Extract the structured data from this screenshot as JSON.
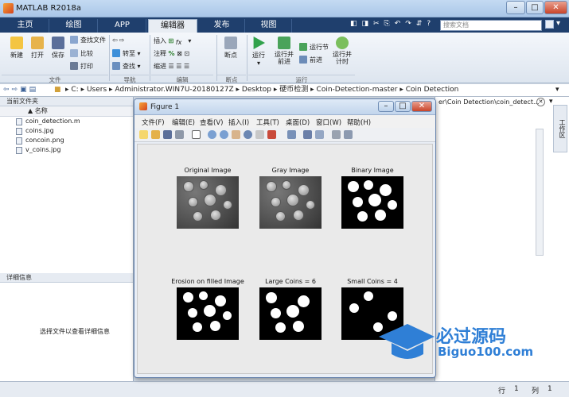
{
  "window": {
    "title": "MATLAB R2018a"
  },
  "tabs": [
    "主页",
    "绘图",
    "APP",
    "编辑器",
    "发布",
    "视图"
  ],
  "active_tab": "编辑器",
  "search": {
    "placeholder": "搜索文档"
  },
  "ribbon": {
    "file": {
      "new": "新建",
      "open": "打开",
      "save": "保存",
      "find_files": "查找文件",
      "compare": "比较",
      "print": "打印",
      "group": "文件"
    },
    "nav": {
      "goto": "转至",
      "find": "查找",
      "group": "导航"
    },
    "edit": {
      "insert": "插入",
      "comment": "注释",
      "indent": "缩进",
      "group": "编辑"
    },
    "breakpoints": {
      "breakpoints": "断点",
      "group": "断点"
    },
    "run": {
      "run": "运行",
      "run_advance": "运行并\n前进",
      "run_section": "运行节",
      "advance": "前进",
      "run_time": "运行并\n计时",
      "group": "运行"
    }
  },
  "address": {
    "parts": [
      "C:",
      "Users",
      "Administrator.WIN7U-20180127Z",
      "Desktop",
      "硬币检测",
      "Coin-Detection-master",
      "Coin Detection"
    ]
  },
  "left_panel": {
    "title": "当前文件夹",
    "column": "名称",
    "files": [
      "coin_detection.m",
      "coins.jpg",
      "concoin.png",
      "v_coins.jpg"
    ],
    "details_title": "详细信息",
    "details_hint": "选择文件以查看详细信息"
  },
  "right_panel": {
    "path": "er\\Coin Detection\\coin_detect...",
    "side_label": "工作区"
  },
  "status": {
    "row_label": "行",
    "row": "1",
    "col_label": "列",
    "col": "1"
  },
  "figure": {
    "title": "Figure 1",
    "menu": [
      "文件(F)",
      "编辑(E)",
      "查看(V)",
      "插入(I)",
      "工具(T)",
      "桌面(D)",
      "窗口(W)",
      "帮助(H)"
    ],
    "subplots": [
      {
        "title": "Original Image"
      },
      {
        "title": "Gray Image"
      },
      {
        "title": "Binary Image"
      },
      {
        "title": "Erosion on filled Image"
      },
      {
        "title": "Large Coins = 6"
      },
      {
        "title": "Small Coins = 4"
      }
    ]
  },
  "watermark": {
    "cn": "必过源码",
    "en": "Biguo100.com"
  },
  "colors": {
    "tabbar": "#1f3f6d",
    "accent": "#2f7fd6"
  }
}
